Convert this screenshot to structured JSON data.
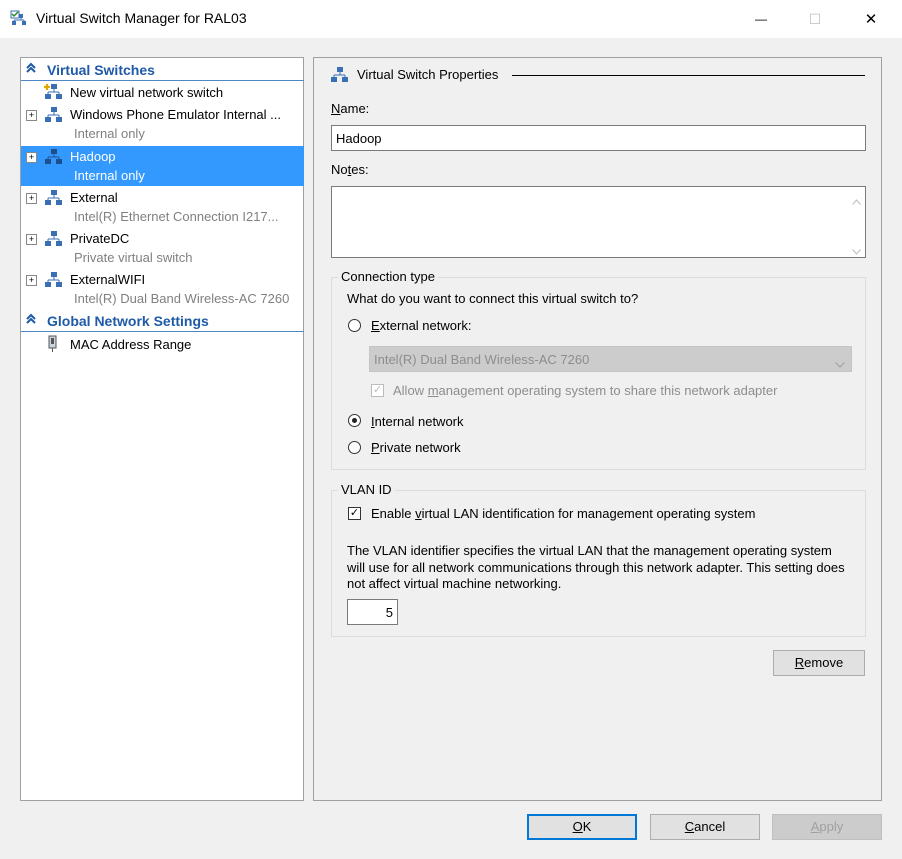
{
  "window": {
    "title": "Virtual Switch Manager for RAL03",
    "icon": "switch-manager-icon",
    "minimize_glyph": "—",
    "maximize_glyph": "☐",
    "close_glyph": "✕"
  },
  "left_pane": {
    "virtual_switches_header": "Virtual Switches",
    "global_settings_header": "Global Network Settings",
    "items": [
      {
        "name": "New virtual network switch",
        "sub": ""
      },
      {
        "name": "Windows Phone Emulator Internal ...",
        "sub": "Internal only"
      },
      {
        "name": "Hadoop",
        "sub": "Internal only"
      },
      {
        "name": "External",
        "sub": "Intel(R) Ethernet Connection I217..."
      },
      {
        "name": "PrivateDC",
        "sub": "Private virtual switch"
      },
      {
        "name": "ExternalWIFI",
        "sub": "Intel(R) Dual Band Wireless-AC 7260"
      }
    ],
    "mac_address_range": "MAC Address Range"
  },
  "properties": {
    "section_title": "Virtual Switch Properties",
    "name_label_u": "N",
    "name_label_rest": "ame:",
    "name_value": "Hadoop",
    "notes_label_a": "No",
    "notes_label_u": "t",
    "notes_label_b": "es:",
    "notes_value": "",
    "connection_type": {
      "title": "Connection type",
      "question": "What do you want to connect this virtual switch to?",
      "external_u": "E",
      "external_rest": "xternal network:",
      "adapter_selected": "Intel(R) Dual Band Wireless-AC 7260",
      "allow_a": "Allow ",
      "allow_u": "m",
      "allow_b": "anagement operating system to share this network adapter",
      "internal_u": "I",
      "internal_rest": "nternal network",
      "private_u": "P",
      "private_rest": "rivate network",
      "selected": "internal"
    },
    "vlan": {
      "title": "VLAN ID",
      "enable_a": "Enable ",
      "enable_u": "v",
      "enable_b": "irtual LAN identification for management operating system",
      "enabled": true,
      "description": "The VLAN identifier specifies the virtual LAN that the management operating system will use for all network communications through this network adapter. This setting does not affect virtual machine networking.",
      "value": "5"
    },
    "remove_u": "R",
    "remove_rest": "emove"
  },
  "buttons": {
    "ok_u": "O",
    "ok_rest": "K",
    "cancel_u": "C",
    "cancel_rest": "ancel",
    "apply_u": "A",
    "apply_rest": "pply"
  },
  "colors": {
    "selection": "#3399ff",
    "category_text": "#1e5aa8",
    "default_button_border": "#0078d7"
  }
}
